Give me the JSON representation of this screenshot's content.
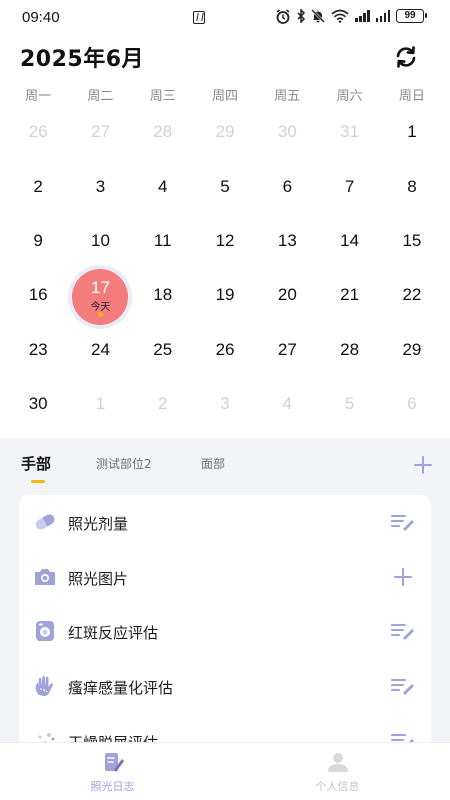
{
  "status_bar": {
    "time": "09:40",
    "battery": "99"
  },
  "calendar": {
    "title": "2025年6月",
    "weekdays": [
      "周一",
      "周二",
      "周三",
      "周四",
      "周五",
      "周六",
      "周日"
    ],
    "today_label": "今天",
    "days": [
      {
        "n": "26",
        "other": true
      },
      {
        "n": "27",
        "other": true
      },
      {
        "n": "28",
        "other": true
      },
      {
        "n": "29",
        "other": true
      },
      {
        "n": "30",
        "other": true
      },
      {
        "n": "31",
        "other": true
      },
      {
        "n": "1",
        "other": false
      },
      {
        "n": "2",
        "other": false
      },
      {
        "n": "3",
        "other": false
      },
      {
        "n": "4",
        "other": false
      },
      {
        "n": "5",
        "other": false
      },
      {
        "n": "6",
        "other": false
      },
      {
        "n": "7",
        "other": false
      },
      {
        "n": "8",
        "other": false
      },
      {
        "n": "9",
        "other": false
      },
      {
        "n": "10",
        "other": false
      },
      {
        "n": "11",
        "other": false
      },
      {
        "n": "12",
        "other": false
      },
      {
        "n": "13",
        "other": false
      },
      {
        "n": "14",
        "other": false
      },
      {
        "n": "15",
        "other": false
      },
      {
        "n": "16",
        "other": false
      },
      {
        "n": "17",
        "other": false,
        "today": true
      },
      {
        "n": "18",
        "other": false
      },
      {
        "n": "19",
        "other": false
      },
      {
        "n": "20",
        "other": false
      },
      {
        "n": "21",
        "other": false
      },
      {
        "n": "22",
        "other": false
      },
      {
        "n": "23",
        "other": false
      },
      {
        "n": "24",
        "other": false
      },
      {
        "n": "25",
        "other": false
      },
      {
        "n": "26",
        "other": false
      },
      {
        "n": "27",
        "other": false
      },
      {
        "n": "28",
        "other": false
      },
      {
        "n": "29",
        "other": false
      },
      {
        "n": "30",
        "other": false
      },
      {
        "n": "1",
        "other": true
      },
      {
        "n": "2",
        "other": true
      },
      {
        "n": "3",
        "other": true
      },
      {
        "n": "4",
        "other": true
      },
      {
        "n": "5",
        "other": true
      },
      {
        "n": "6",
        "other": true
      }
    ]
  },
  "tabs": [
    {
      "label": "手部",
      "active": true
    },
    {
      "label": "测试部位2",
      "active": false
    },
    {
      "label": "面部",
      "active": false
    }
  ],
  "records": [
    {
      "label": "照光剂量",
      "icon": "pill-icon",
      "action": "edit-icon"
    },
    {
      "label": "照光图片",
      "icon": "camera-icon",
      "action": "add-icon"
    },
    {
      "label": "红斑反应评估",
      "icon": "skin-patch-icon",
      "action": "edit-icon"
    },
    {
      "label": "瘙痒感量化评估",
      "icon": "hand-icon",
      "action": "edit-icon"
    },
    {
      "label": "干燥脱屑评估",
      "icon": "flakes-icon",
      "action": "edit-icon"
    }
  ],
  "bottom_nav": [
    {
      "label": "照光日志",
      "icon": "journal-icon",
      "active": true
    },
    {
      "label": "个人信息",
      "icon": "person-icon",
      "active": false
    }
  ],
  "colors": {
    "accent": "#f2b90e",
    "today": "#f47c7c",
    "icon": "#9ea3d9"
  }
}
